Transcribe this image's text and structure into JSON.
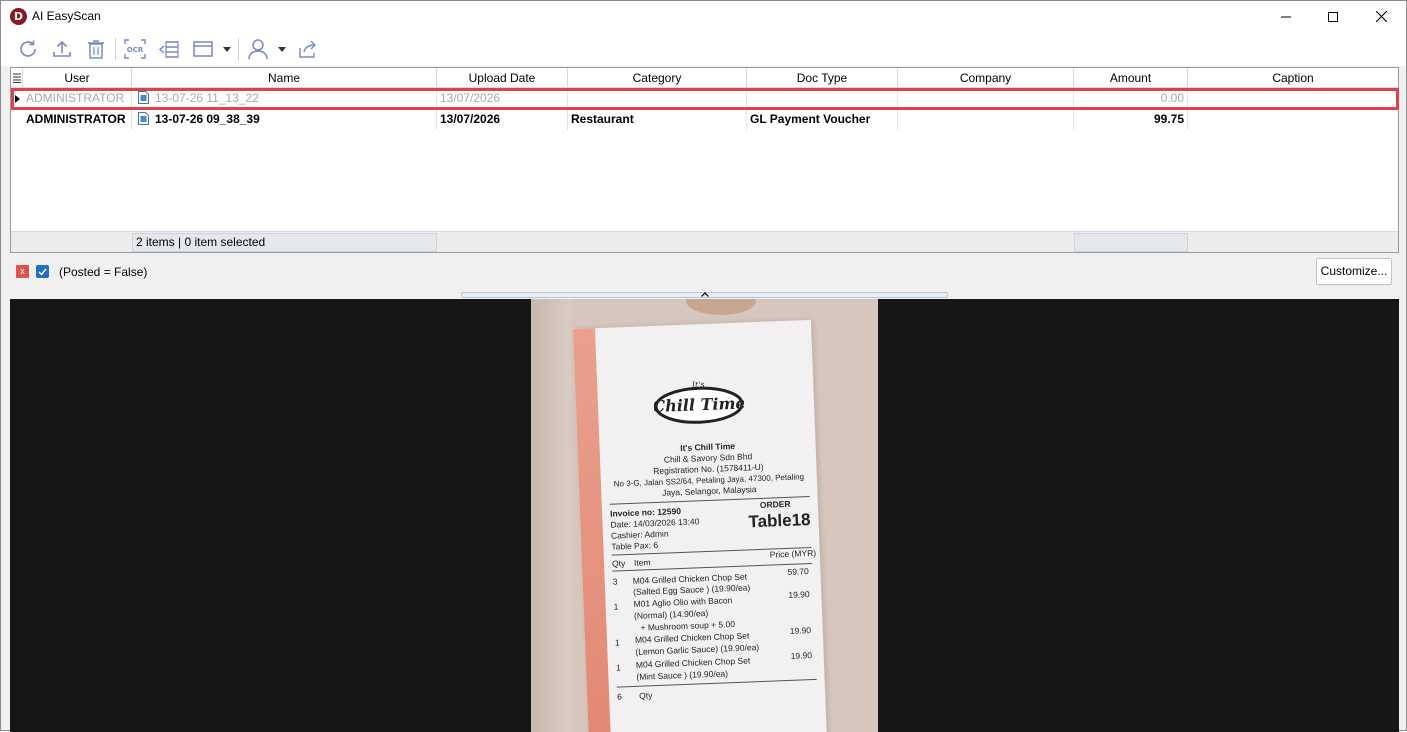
{
  "window": {
    "title": "AI EasyScan",
    "app_icon": "D",
    "controls": [
      "minimize-icon",
      "maximize-icon",
      "close-icon"
    ]
  },
  "toolbar": {
    "items": [
      "refresh-icon",
      "upload-icon",
      "delete-icon",
      "ocr-icon",
      "outdent-list-icon",
      "layout-icon",
      "user-icon",
      "share-icon"
    ],
    "ocr_label": "OCR"
  },
  "grid": {
    "columns": [
      "User",
      "Name",
      "Upload Date",
      "Category",
      "Doc Type",
      "Company",
      "Amount",
      "Caption"
    ],
    "rows": [
      {
        "user": "ADMINISTRATOR",
        "name": "13-07-26 11_13_22",
        "upload_date": "13/07/2026",
        "category": "",
        "doc_type": "",
        "company": "",
        "amount": "0.00",
        "caption": "",
        "style": "dim",
        "selected": true
      },
      {
        "user": "ADMINISTRATOR",
        "name": "13-07-26 09_38_39",
        "upload_date": "13/07/2026",
        "category": "Restaurant",
        "doc_type": "GL Payment Voucher",
        "company": "",
        "amount": "99.75",
        "caption": "",
        "style": "bold",
        "selected": false
      }
    ],
    "footer": {
      "summary": "2 items |  0 item selected"
    }
  },
  "filter": {
    "text": "(Posted = False)",
    "enabled": true,
    "customize_label": "Customize..."
  },
  "receipt": {
    "logo_text": "Chill Time",
    "logo_small": "It's",
    "shop_name": "It's Chill Time",
    "company": "Chill & Savory Sdn Bhd",
    "registration": "Registration No. (1578411-U)",
    "address1": "No 3-G, Jalan SS2/64, Petaling Jaya, 47300, Petaling",
    "address2": "Jaya, Selangor, Malaysia",
    "invoice": "Invoice no: 12590",
    "order_label": "ORDER",
    "date": "Date: 14/03/2026 13:40",
    "table": "Table18",
    "cashier": "Cashier: Admin",
    "pax": "Table Pax: 6",
    "col_qty": "Qty",
    "col_item": "Item",
    "col_price": "Price (MYR)",
    "items": [
      {
        "qty": "3",
        "line1": "M04 Grilled Chicken Chop Set",
        "line2": "(Salted Egg Sauce )  (19.90/ea)",
        "price": "59.70"
      },
      {
        "qty": "1",
        "line1": "M01 Aglio Olio with Bacon",
        "line2": "(Normal)  (14.90/ea)",
        "line3": "+ Mushroom soup   + 5.00",
        "price": "19.90"
      },
      {
        "qty": "1",
        "line1": "M04 Grilled Chicken Chop Set",
        "line2": "(Lemon Garlic Sauce)  (19.90/ea)",
        "price": "19.90"
      },
      {
        "qty": "1",
        "line1": "M04 Grilled Chicken Chop Set",
        "line2": "(Mint Sauce )  (19.90/ea)",
        "price": "19.90"
      }
    ],
    "total_qty": "6",
    "total_qty_label": "Qty"
  },
  "colors": {
    "highlight": "#e0404a",
    "accent_icon": "#7a6fc8",
    "app_icon_bg": "#8a1622",
    "preview_bg": "#161616"
  }
}
